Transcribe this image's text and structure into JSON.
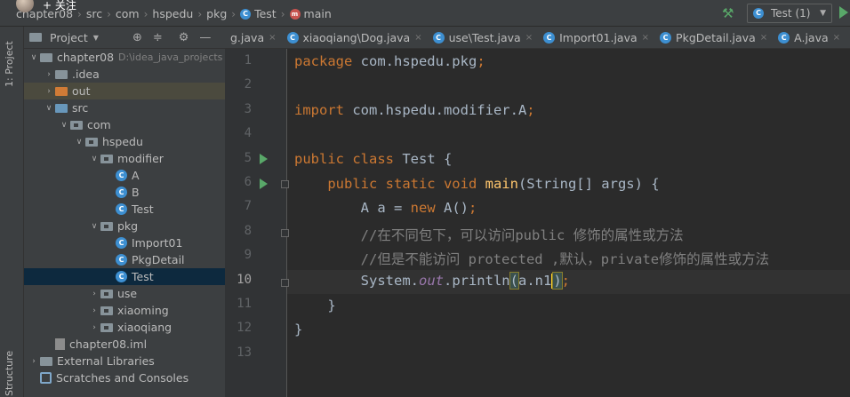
{
  "navbar": {
    "follow_label": "+ 关注",
    "breadcrumbs": [
      {
        "label": "chapter08",
        "icon": ""
      },
      {
        "label": "src",
        "icon": ""
      },
      {
        "label": "com",
        "icon": ""
      },
      {
        "label": "hspedu",
        "icon": ""
      },
      {
        "label": "pkg",
        "icon": ""
      },
      {
        "label": "Test",
        "icon": "class-icon"
      },
      {
        "label": "main",
        "icon": "method-icon"
      }
    ],
    "class_icon_glyph": "C",
    "method_icon_glyph": "m",
    "run_config": "Test (1)"
  },
  "toolstrip": {
    "project_tab": "1: Project",
    "structure_tab": "Structure"
  },
  "project_panel": {
    "title": "Project",
    "tree": [
      {
        "label": "chapter08",
        "path": "D:\\idea_java_projects",
        "type": "module",
        "depth": 0,
        "expanded": true
      },
      {
        "label": ".idea",
        "type": "folder-grey",
        "depth": 1,
        "expanded": false
      },
      {
        "label": "out",
        "type": "folder-orange",
        "depth": 1,
        "expanded": false,
        "highlight": true
      },
      {
        "label": "src",
        "type": "folder-blue",
        "depth": 1,
        "expanded": true
      },
      {
        "label": "com",
        "type": "package",
        "depth": 2,
        "expanded": true
      },
      {
        "label": "hspedu",
        "type": "package",
        "depth": 3,
        "expanded": true
      },
      {
        "label": "modifier",
        "type": "package",
        "depth": 4,
        "expanded": true
      },
      {
        "label": "A",
        "type": "class",
        "depth": 5
      },
      {
        "label": "B",
        "type": "class",
        "depth": 5
      },
      {
        "label": "Test",
        "type": "class",
        "depth": 5
      },
      {
        "label": "pkg",
        "type": "package",
        "depth": 4,
        "expanded": true
      },
      {
        "label": "Import01",
        "type": "class",
        "depth": 5
      },
      {
        "label": "PkgDetail",
        "type": "class",
        "depth": 5
      },
      {
        "label": "Test",
        "type": "class",
        "depth": 5,
        "selected": true
      },
      {
        "label": "use",
        "type": "package",
        "depth": 4,
        "expanded": false
      },
      {
        "label": "xiaoming",
        "type": "package",
        "depth": 4,
        "expanded": false
      },
      {
        "label": "xiaoqiang",
        "type": "package",
        "depth": 4,
        "expanded": false
      },
      {
        "label": "chapter08.iml",
        "type": "iml",
        "depth": 1
      },
      {
        "label": "External Libraries",
        "type": "library",
        "depth": 0,
        "expanded": false
      },
      {
        "label": "Scratches and Consoles",
        "type": "scratch",
        "depth": 0
      }
    ]
  },
  "tabs": [
    {
      "label": "g.java"
    },
    {
      "label": "xiaoqiang\\Dog.java"
    },
    {
      "label": "use\\Test.java"
    },
    {
      "label": "Import01.java"
    },
    {
      "label": "PkgDetail.java"
    },
    {
      "label": "A.java"
    }
  ],
  "editor": {
    "line_numbers": [
      "1",
      "2",
      "3",
      "4",
      "5",
      "6",
      "7",
      "8",
      "9",
      "10",
      "11",
      "12",
      "13"
    ],
    "current_line": 10
  },
  "colors": {
    "keyword": "#cc7832",
    "method": "#ffc66d",
    "comment": "#808080",
    "static_field": "#9876aa",
    "default_text": "#a9b7c6",
    "run_green": "#59a869",
    "class_blue": "#3d8fd1"
  }
}
